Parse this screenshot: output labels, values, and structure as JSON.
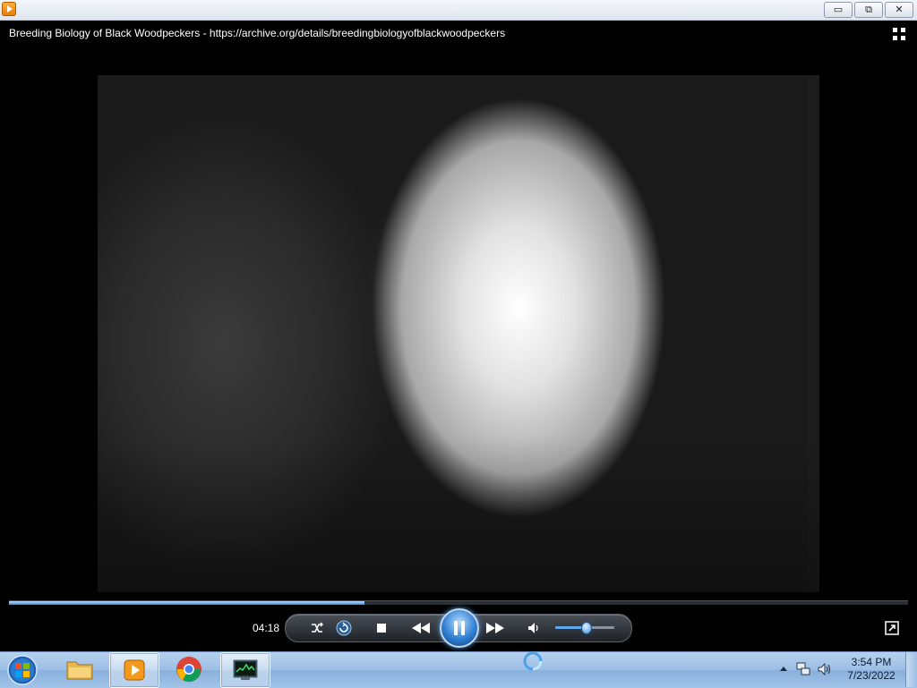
{
  "window": {
    "app_icon": "media-player-icon",
    "minimize": "▭",
    "restore": "⧉",
    "close": "✕"
  },
  "video": {
    "title": "Breeding Biology of Black Woodpeckers - https://archive.org/details/breedingbiologyofblackwoodpeckers"
  },
  "controls": {
    "time": "04:18",
    "progress_percent": 39.5,
    "volume_percent": 52,
    "state": "playing",
    "accent_color": "#3d86d6"
  },
  "taskbar": {
    "pinned": [
      "start-orb",
      "explorer",
      "media-player",
      "chrome",
      "task-manager"
    ],
    "clock_time": "3:54 PM",
    "clock_date": "7/23/2022"
  }
}
